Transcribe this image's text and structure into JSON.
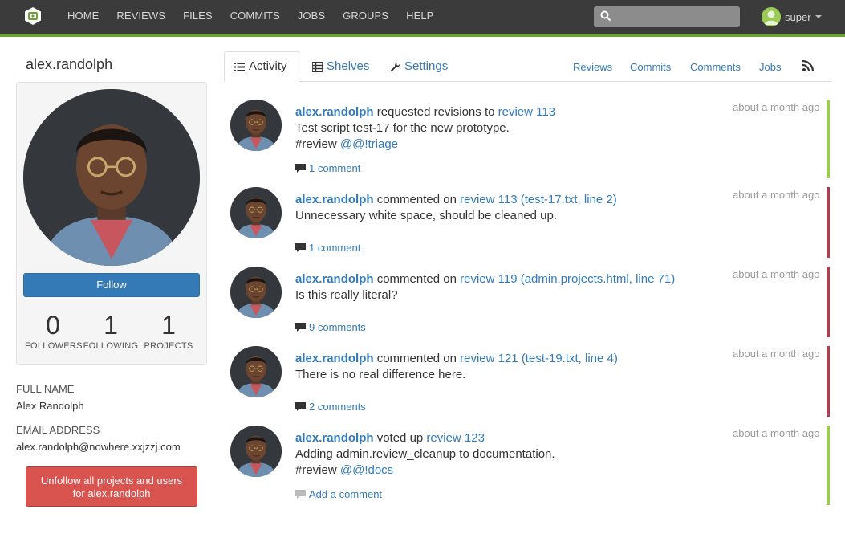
{
  "nav": {
    "items": [
      "HOME",
      "REVIEWS",
      "FILES",
      "COMMITS",
      "JOBS",
      "GROUPS",
      "HELP"
    ],
    "search_placeholder": "",
    "user": "super"
  },
  "profile": {
    "username": "alex.randolph",
    "follow_label": "Follow",
    "stats": [
      {
        "value": "0",
        "label": "FOLLOWERS"
      },
      {
        "value": "1",
        "label": "FOLLOWING"
      },
      {
        "value": "1",
        "label": "PROJECTS"
      }
    ],
    "full_name_label": "FULL NAME",
    "full_name": "Alex Randolph",
    "email_label": "EMAIL ADDRESS",
    "email": "alex.randolph@nowhere.xxjzzj.com",
    "unfollow_line1": "Unfollow all projects and users",
    "unfollow_line2": "for alex.randolph"
  },
  "tabs": {
    "activity": "Activity",
    "shelves": "Shelves",
    "settings": "Settings"
  },
  "filters": [
    "Reviews",
    "Commits",
    "Comments",
    "Jobs"
  ],
  "colors": {
    "brand_green": "#6aa42f",
    "link_blue": "#337ab7",
    "approve_green": "#9bcb54",
    "reject_red": "#a94250"
  },
  "activities": [
    {
      "actor": "alex.randolph",
      "action": "requested revisions to",
      "target": "review 113",
      "text": "Test script test-17 for the new prototype.",
      "hashtag": "#review",
      "mention": "@@!triage",
      "comments": "1 comment",
      "time": "about a month ago",
      "status_color": "#9bcb54"
    },
    {
      "actor": "alex.randolph",
      "action": "commented on",
      "target": "review 113 (test-17.txt, line 2)",
      "text": "Unnecessary white space, should be cleaned up.",
      "comments": "1 comment",
      "time": "about a month ago",
      "status_color": "#a94250"
    },
    {
      "actor": "alex.randolph",
      "action": "commented on",
      "target": "review 119 (admin.projects.html, line 71)",
      "text": "Is this really literal?",
      "comments": "9 comments",
      "time": "about a month ago",
      "status_color": "#a94250"
    },
    {
      "actor": "alex.randolph",
      "action": "commented on",
      "target": "review 121 (test-19.txt, line 4)",
      "text": "There is no real difference here.",
      "comments": "2 comments",
      "time": "about a month ago",
      "status_color": "#a94250"
    },
    {
      "actor": "alex.randolph",
      "action": "voted up",
      "target": "review 123",
      "text": "Adding admin.review_cleanup to documentation.",
      "hashtag": "#review",
      "mention": "@@!docs",
      "comments": "Add a comment",
      "time": "about a month ago",
      "status_color": "#9bcb54"
    }
  ]
}
